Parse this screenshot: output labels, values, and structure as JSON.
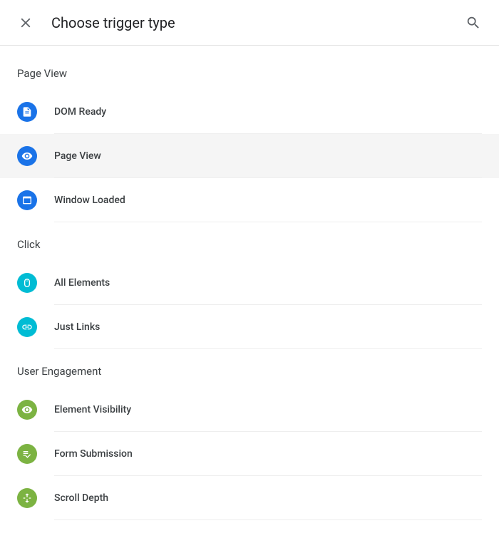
{
  "header": {
    "title": "Choose trigger type"
  },
  "sections": {
    "page_view": {
      "title": "Page View",
      "items": {
        "dom_ready": {
          "label": "DOM Ready"
        },
        "page_view": {
          "label": "Page View"
        },
        "window_loaded": {
          "label": "Window Loaded"
        }
      }
    },
    "click": {
      "title": "Click",
      "items": {
        "all_elements": {
          "label": "All Elements"
        },
        "just_links": {
          "label": "Just Links"
        }
      }
    },
    "user_engagement": {
      "title": "User Engagement",
      "items": {
        "element_visibility": {
          "label": "Element Visibility"
        },
        "form_submission": {
          "label": "Form Submission"
        },
        "scroll_depth": {
          "label": "Scroll Depth"
        }
      }
    }
  }
}
